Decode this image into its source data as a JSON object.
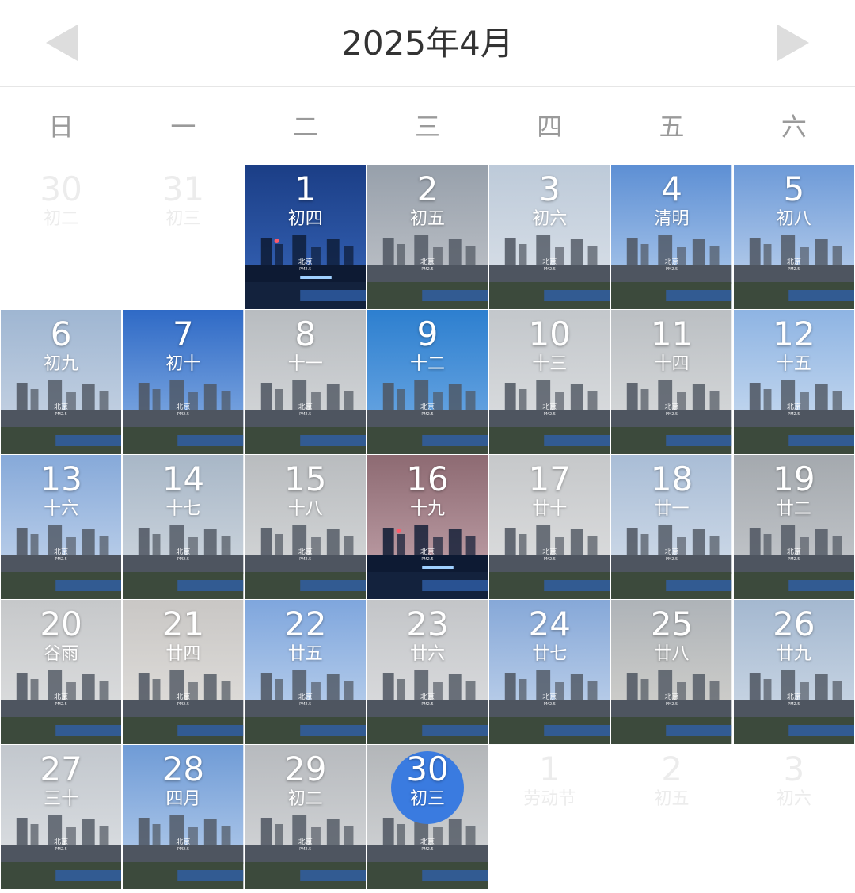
{
  "header": {
    "title": "2025年4月",
    "prev_icon": "triangle-left-icon",
    "next_icon": "triangle-right-icon",
    "arrow_color": "#dddddd"
  },
  "weekdays": [
    "日",
    "一",
    "二",
    "三",
    "四",
    "五",
    "六"
  ],
  "accent_today": "#3a7be0",
  "stamp": {
    "city": "北京",
    "pm": "PM2.5"
  },
  "days": [
    {
      "num": "30",
      "lunar": "初二",
      "state": "other"
    },
    {
      "num": "31",
      "lunar": "初三",
      "state": "other"
    },
    {
      "num": "1",
      "lunar": "初四",
      "sky": [
        "#1b3e86",
        "#3867bb"
      ],
      "night": true
    },
    {
      "num": "2",
      "lunar": "初五",
      "sky": [
        "#97a0ab",
        "#c4c7cc"
      ]
    },
    {
      "num": "3",
      "lunar": "初六",
      "sky": [
        "#bdcad9",
        "#dde3ea"
      ]
    },
    {
      "num": "4",
      "lunar": "清明",
      "sky": [
        "#5d8fd4",
        "#b7d0ee"
      ]
    },
    {
      "num": "5",
      "lunar": "初八",
      "sky": [
        "#6d9ad8",
        "#c6d8ef"
      ]
    },
    {
      "num": "6",
      "lunar": "初九",
      "sky": [
        "#9fb6d2",
        "#cdd8e6"
      ]
    },
    {
      "num": "7",
      "lunar": "初十",
      "sky": [
        "#2f6ac6",
        "#8fb6e7"
      ]
    },
    {
      "num": "8",
      "lunar": "十一",
      "sky": [
        "#b8bcc0",
        "#dadcde"
      ]
    },
    {
      "num": "9",
      "lunar": "十二",
      "sky": [
        "#2d7fcf",
        "#76aee6"
      ]
    },
    {
      "num": "10",
      "lunar": "十三",
      "sky": [
        "#c3c7cb",
        "#dfe1e3"
      ]
    },
    {
      "num": "11",
      "lunar": "十四",
      "sky": [
        "#bbbfc3",
        "#dcdedf"
      ]
    },
    {
      "num": "12",
      "lunar": "十五",
      "sky": [
        "#8eb4e3",
        "#d1e0f1"
      ]
    },
    {
      "num": "13",
      "lunar": "十六",
      "sky": [
        "#86a9d9",
        "#c9d9ee"
      ]
    },
    {
      "num": "14",
      "lunar": "十七",
      "sky": [
        "#a8b7c7",
        "#d4dbe2"
      ]
    },
    {
      "num": "15",
      "lunar": "十八",
      "sky": [
        "#b9bcbf",
        "#d9dbdc"
      ]
    },
    {
      "num": "16",
      "lunar": "十九",
      "sky": [
        "#8d6a72",
        "#c8a9b1"
      ],
      "night": true
    },
    {
      "num": "17",
      "lunar": "廿十",
      "sky": [
        "#c6c8ca",
        "#e0e1e2"
      ]
    },
    {
      "num": "18",
      "lunar": "廿一",
      "sky": [
        "#a9bdd6",
        "#d6e0ec"
      ]
    },
    {
      "num": "19",
      "lunar": "廿二",
      "sky": [
        "#a4a9ae",
        "#c9ccd0"
      ]
    },
    {
      "num": "20",
      "lunar": "谷雨",
      "sky": [
        "#c6c8ca",
        "#e1e2e3"
      ]
    },
    {
      "num": "21",
      "lunar": "廿四",
      "sky": [
        "#c9c7c5",
        "#e4e2df"
      ]
    },
    {
      "num": "22",
      "lunar": "廿五",
      "sky": [
        "#7fa6dd",
        "#c5d8ef"
      ]
    },
    {
      "num": "23",
      "lunar": "廿六",
      "sky": [
        "#c3c5c8",
        "#e0e1e3"
      ]
    },
    {
      "num": "24",
      "lunar": "廿七",
      "sky": [
        "#86a8d8",
        "#c9d9ee"
      ]
    },
    {
      "num": "25",
      "lunar": "廿八",
      "sky": [
        "#aeb3b8",
        "#d8d6d0"
      ]
    },
    {
      "num": "26",
      "lunar": "廿九",
      "sky": [
        "#a4b8d0",
        "#d2dde9"
      ]
    },
    {
      "num": "27",
      "lunar": "三十",
      "sky": [
        "#c2c7cd",
        "#e0e3e6"
      ]
    },
    {
      "num": "28",
      "lunar": "四月",
      "sky": [
        "#6f9bd6",
        "#bcd2ee"
      ]
    },
    {
      "num": "29",
      "lunar": "初二",
      "sky": [
        "#b7babe",
        "#d8dadc"
      ]
    },
    {
      "num": "30",
      "lunar": "初三",
      "sky": [
        "#b3b6b9",
        "#d6d8da"
      ],
      "today": true
    },
    {
      "num": "1",
      "lunar": "劳动节",
      "state": "other"
    },
    {
      "num": "2",
      "lunar": "初五",
      "state": "other"
    },
    {
      "num": "3",
      "lunar": "初六",
      "state": "other"
    }
  ]
}
